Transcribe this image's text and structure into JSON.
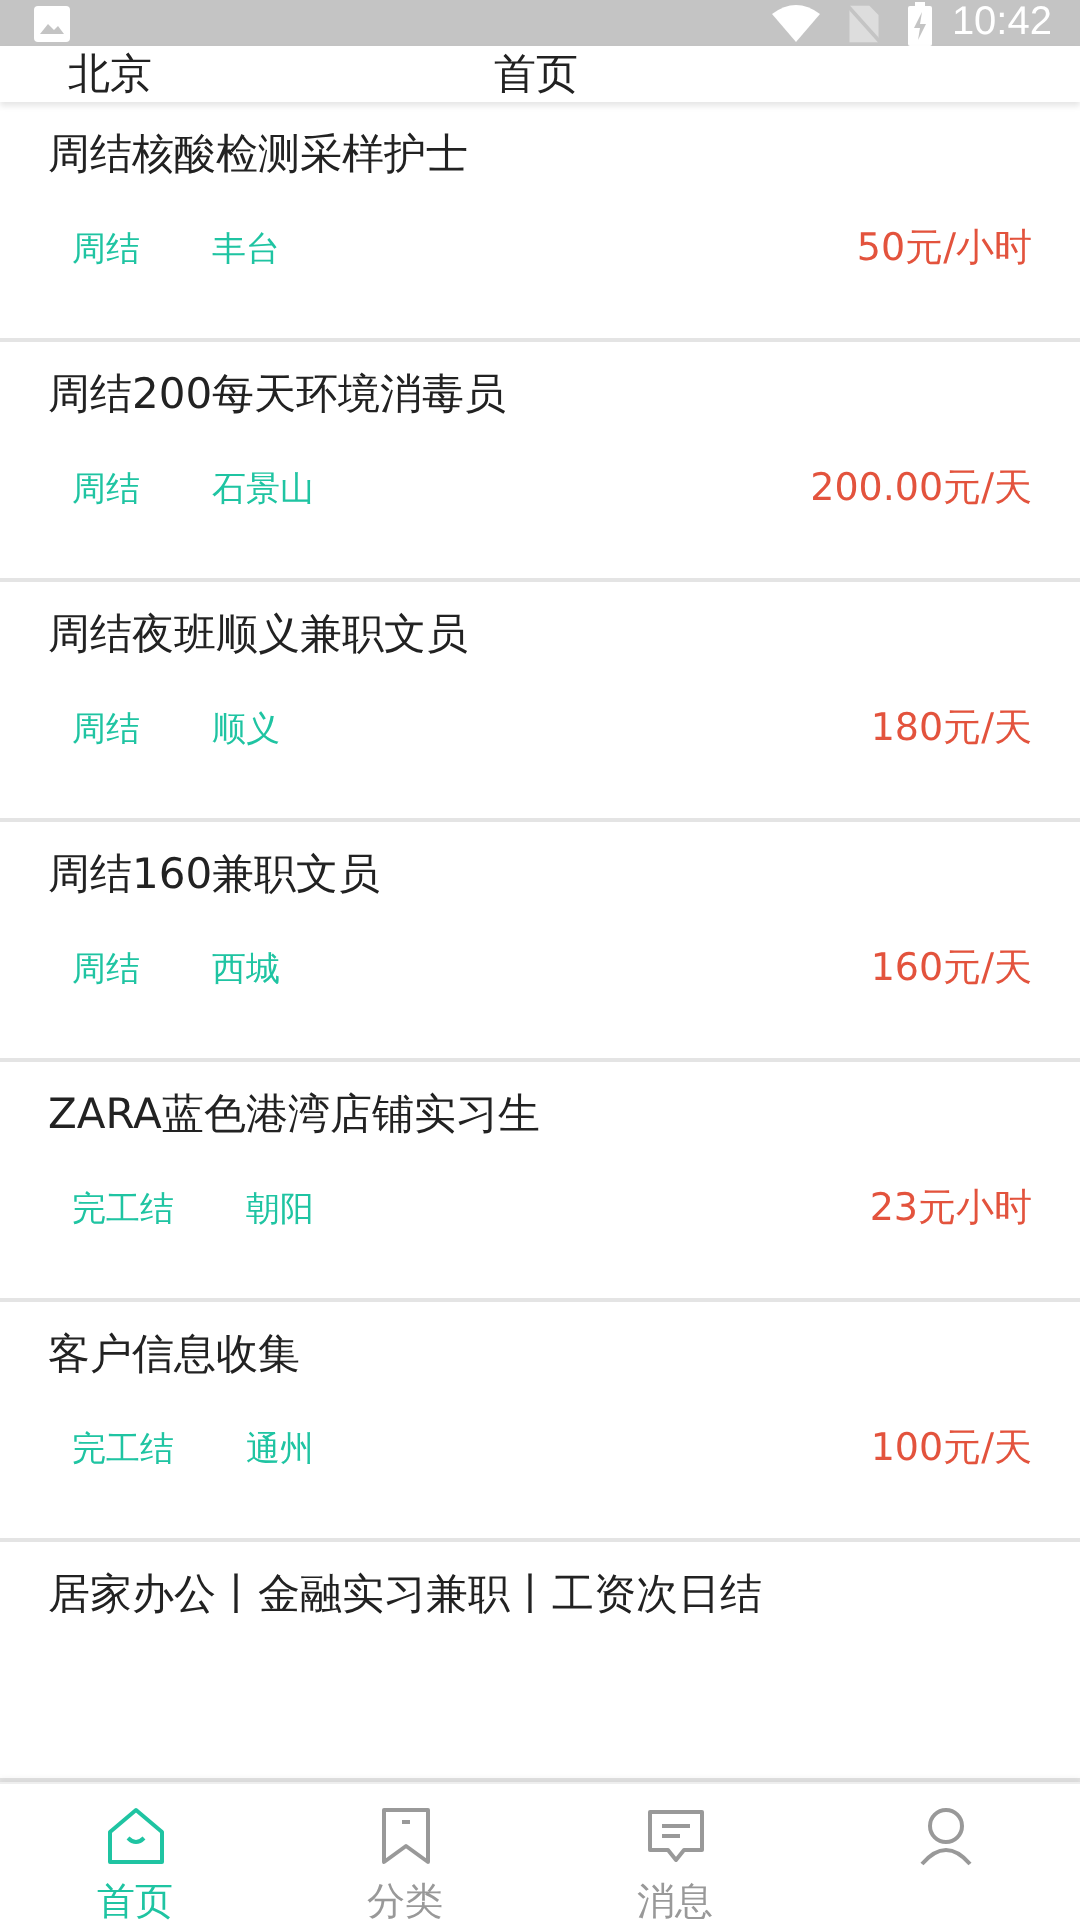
{
  "status_bar": {
    "time": "10:42"
  },
  "header": {
    "city": "北京",
    "title": "首页"
  },
  "jobs": [
    {
      "title": "周结核酸检测采样护士",
      "tags": [
        "周结",
        "丰台"
      ],
      "salary": "50元/小时"
    },
    {
      "title": "周结200每天环境消毒员",
      "tags": [
        "周结",
        "石景山"
      ],
      "salary": "200.00元/天"
    },
    {
      "title": "周结夜班顺义兼职文员",
      "tags": [
        "周结",
        "顺义"
      ],
      "salary": "180元/天"
    },
    {
      "title": "周结160兼职文员",
      "tags": [
        "周结",
        "西城"
      ],
      "salary": "160元/天"
    },
    {
      "title": "ZARA蓝色港湾店铺实习生",
      "tags": [
        "完工结",
        "朝阳"
      ],
      "salary": "23元小时"
    },
    {
      "title": "客户信息收集",
      "tags": [
        "完工结",
        "通州"
      ],
      "salary": "100元/天"
    },
    {
      "title": "居家办公丨金融实习兼职丨工资次日结"
    }
  ],
  "tabs": [
    {
      "kind": "home",
      "label": "首页",
      "selected": true
    },
    {
      "kind": "category",
      "label": "分类",
      "selected": false
    },
    {
      "kind": "message",
      "label": "消息",
      "selected": false
    },
    {
      "kind": "profile",
      "selected": false
    }
  ]
}
